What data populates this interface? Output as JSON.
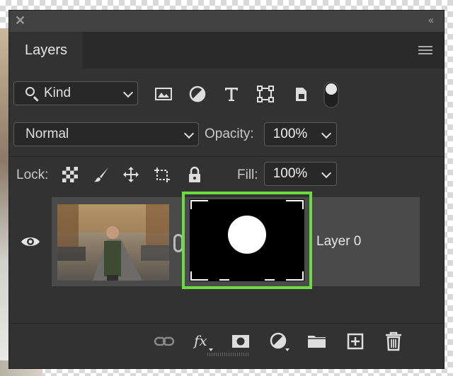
{
  "panel": {
    "tab_label": "Layers",
    "close_glyph": "✕",
    "collapse_glyph": "‹‹"
  },
  "filter": {
    "kind_label": "Kind",
    "icons": [
      "image-filter-icon",
      "adjustment-filter-icon",
      "type-filter-icon",
      "shape-filter-icon",
      "smart-object-filter-icon",
      "filter-toggle-icon"
    ]
  },
  "blend": {
    "mode": "Normal",
    "opacity_label": "Opacity:",
    "opacity_value": "100%"
  },
  "lock": {
    "label": "Lock:",
    "fill_label": "Fill:",
    "fill_value": "100%",
    "icons": [
      "lock-transparent-pixels-icon",
      "lock-image-pixels-icon",
      "lock-position-icon",
      "lock-artboard-icon",
      "lock-all-icon"
    ]
  },
  "layers": [
    {
      "name": "Layer 0",
      "visible": true,
      "mask_selected": true
    }
  ],
  "bottom_icons": [
    "link-layers-icon",
    "fx-icon",
    "add-mask-icon",
    "adjustment-layer-icon",
    "group-folder-icon",
    "new-layer-icon",
    "delete-icon"
  ],
  "colors": {
    "panel_bg": "#323232",
    "selected_row": "#4a4a4a",
    "mask_highlight": "#6bdc3e"
  }
}
